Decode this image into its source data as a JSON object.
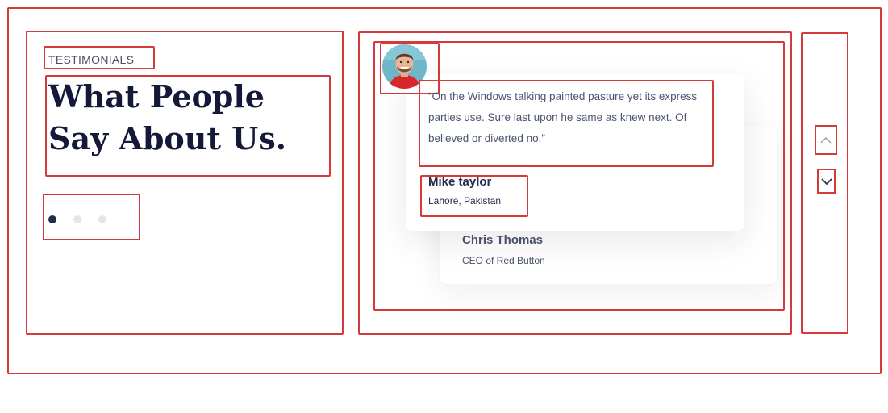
{
  "section": {
    "eyebrow": "TESTIMONIALS",
    "title": "What People Say About Us."
  },
  "pagination": {
    "dots": [
      {
        "active": true
      },
      {
        "active": false
      },
      {
        "active": false
      }
    ]
  },
  "testimonials": {
    "active": {
      "quote": "“On the Windows talking painted pasture yet its express parties use. Sure last upon he same as knew next. Of believed or diverted no.”",
      "name": "Mike taylor",
      "location": "Lahore, Pakistan",
      "avatar": "avatar-photo"
    },
    "next": {
      "name": "Chris Thomas",
      "role": "CEO of Red Button"
    }
  },
  "controls": {
    "prev_icon": "chevron-up-icon",
    "next_icon": "chevron-down-icon"
  },
  "colors": {
    "annotation": "#d7393a",
    "heading": "#14193a",
    "text": "#4b5471",
    "dot_active": "#252d4d",
    "dot_inactive": "#e4e6ee"
  }
}
